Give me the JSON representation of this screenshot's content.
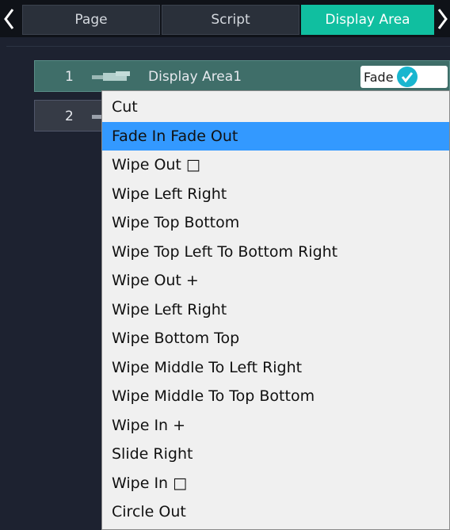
{
  "tabs": {
    "prev_icon": "chevron-left-icon",
    "next_icon": "chevron-right-icon",
    "items": [
      "Page",
      "Script",
      "Display Area"
    ],
    "active_index": 2,
    "active_color": "#10bfa0"
  },
  "display_areas": [
    {
      "number": "1",
      "name": "Display Area1",
      "mode": "Fade In",
      "selected": true
    },
    {
      "number": "2"
    }
  ],
  "transition_menu": {
    "selected": "Fade In Fade Out",
    "options": [
      "Cut",
      "Fade In Fade Out",
      "Wipe Out □",
      "Wipe Left Right",
      "Wipe Top Bottom",
      "Wipe Top Left To Bottom Right",
      "Wipe Out +",
      "Wipe Left Right",
      "Wipe Bottom Top",
      "Wipe Middle To Left Right",
      "Wipe Middle To Top Bottom",
      "Wipe In +",
      "Slide Right",
      "Wipe In □",
      "Circle Out"
    ]
  },
  "colors": {
    "highlight": "#3399ff",
    "check": "#19b6cf"
  }
}
